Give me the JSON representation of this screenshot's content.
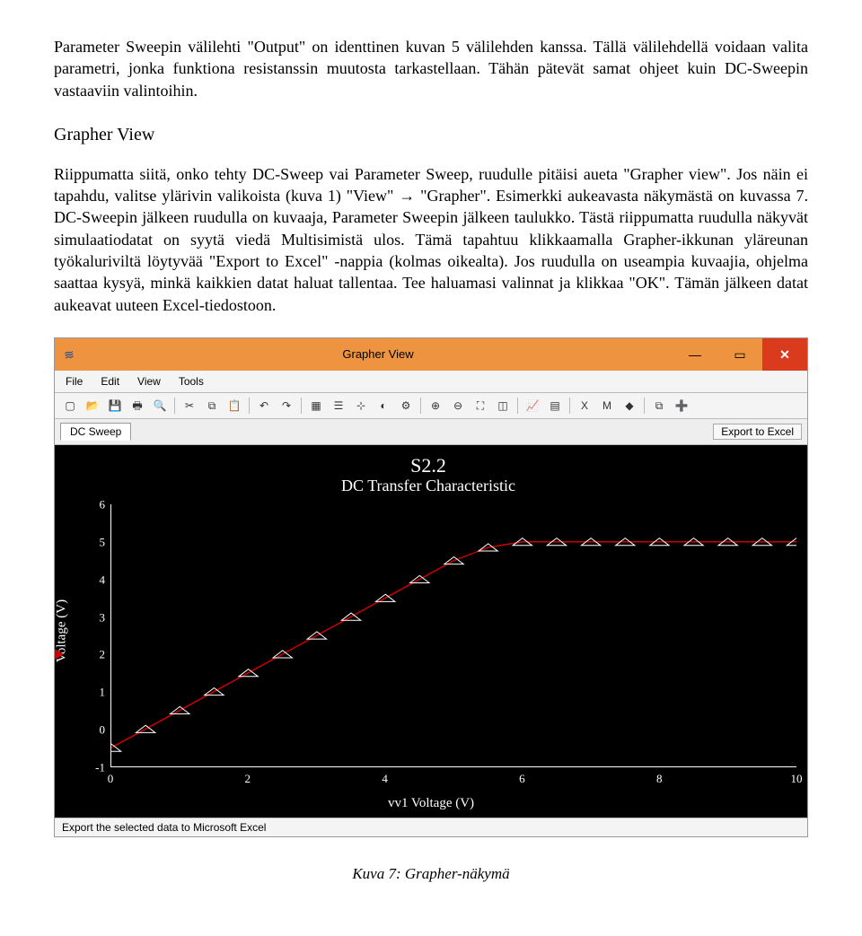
{
  "document": {
    "para1": "Parameter Sweepin välilehti \"Output\" on identtinen kuvan 5 välilehden kanssa. Tällä välilehdellä voidaan valita parametri, jonka funktiona resistanssin muutosta tarkastellaan. Tähän pätevät samat ohjeet kuin DC-Sweepin vastaaviin valintoihin.",
    "heading": "Grapher View",
    "para2": "Riippumatta siitä, onko tehty DC-Sweep vai Parameter Sweep, ruudulle pitäisi aueta \"Grapher view\". Jos näin ei tapahdu, valitse ylärivin valikoista (kuva 1) \"View\" → \"Grapher\". Esimerkki aukeavasta näkymästä on kuvassa 7. DC-Sweepin jälkeen ruudulla on kuvaaja, Parameter Sweepin jälkeen taulukko. Tästä riippumatta ruudulla näkyvät simulaatiodatat on syytä viedä Multisimistä ulos. Tämä tapahtuu klikkaamalla Grapher-ikkunan yläreunan työkaluriviltä löytyvää \"Export to Excel\" -nappia (kolmas oikealta). Jos ruudulla on useampia kuvaajia, ohjelma saattaa kysyä, minkä kaikkien datat haluat tallentaa. Tee haluamasi valinnat ja klikkaa \"OK\". Tämän jälkeen datat aukeavat uuteen Excel-tiedostoon.",
    "caption": "Kuva 7: Grapher-näkymä"
  },
  "window": {
    "title": "Grapher View",
    "menus": [
      "File",
      "Edit",
      "View",
      "Tools"
    ],
    "tab": "DC Sweep",
    "export_label": "Export to Excel",
    "status": "Export the selected data to Microsoft Excel"
  },
  "chart_data": {
    "type": "line",
    "title": "S2.2",
    "subtitle": "DC Transfer Characteristic",
    "xlabel": "vv1 Voltage (V)",
    "ylabel": "Voltage (V)",
    "xlim": [
      0,
      10
    ],
    "ylim": [
      -1,
      6
    ],
    "yticks": [
      -1,
      0,
      1,
      2,
      3,
      4,
      5,
      6
    ],
    "xticks": [
      0,
      2,
      4,
      6,
      8,
      10
    ],
    "x": [
      0.0,
      0.5,
      1.0,
      1.5,
      2.0,
      2.5,
      3.0,
      3.5,
      4.0,
      4.5,
      5.0,
      5.5,
      6.0,
      6.5,
      7.0,
      7.5,
      8.0,
      8.5,
      9.0,
      9.5,
      10.0
    ],
    "values": [
      -0.5,
      0.0,
      0.5,
      1.0,
      1.5,
      2.0,
      2.5,
      3.0,
      3.5,
      4.0,
      4.5,
      4.85,
      5.0,
      5.0,
      5.0,
      5.0,
      5.0,
      5.0,
      5.0,
      5.0,
      5.0
    ]
  }
}
